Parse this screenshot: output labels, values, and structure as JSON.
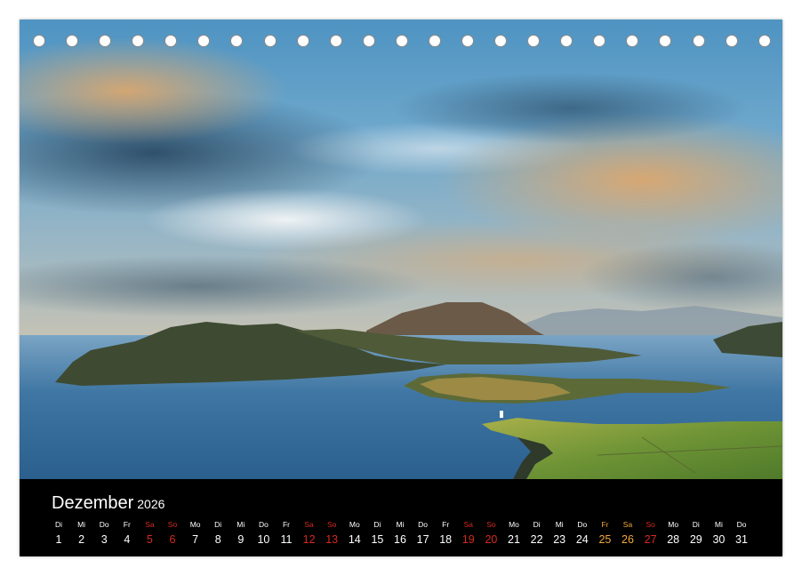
{
  "calendar": {
    "month": "Dezember",
    "year": "2026",
    "ring_count": 23,
    "colors": {
      "weekday": "#ffffff",
      "weekend": "#d62a20",
      "holiday": "#f2a93b"
    },
    "days": [
      {
        "wd": "Di",
        "num": "1",
        "type": "normal"
      },
      {
        "wd": "Mi",
        "num": "2",
        "type": "normal"
      },
      {
        "wd": "Do",
        "num": "3",
        "type": "normal"
      },
      {
        "wd": "Fr",
        "num": "4",
        "type": "normal"
      },
      {
        "wd": "Sa",
        "num": "5",
        "type": "weekend"
      },
      {
        "wd": "So",
        "num": "6",
        "type": "weekend"
      },
      {
        "wd": "Mo",
        "num": "7",
        "type": "normal"
      },
      {
        "wd": "Di",
        "num": "8",
        "type": "normal"
      },
      {
        "wd": "Mi",
        "num": "9",
        "type": "normal"
      },
      {
        "wd": "Do",
        "num": "10",
        "type": "normal"
      },
      {
        "wd": "Fr",
        "num": "11",
        "type": "normal"
      },
      {
        "wd": "Sa",
        "num": "12",
        "type": "weekend"
      },
      {
        "wd": "So",
        "num": "13",
        "type": "weekend"
      },
      {
        "wd": "Mo",
        "num": "14",
        "type": "normal"
      },
      {
        "wd": "Di",
        "num": "15",
        "type": "normal"
      },
      {
        "wd": "Mi",
        "num": "16",
        "type": "normal"
      },
      {
        "wd": "Do",
        "num": "17",
        "type": "normal"
      },
      {
        "wd": "Fr",
        "num": "18",
        "type": "normal"
      },
      {
        "wd": "Sa",
        "num": "19",
        "type": "weekend"
      },
      {
        "wd": "So",
        "num": "20",
        "type": "weekend"
      },
      {
        "wd": "Mo",
        "num": "21",
        "type": "normal"
      },
      {
        "wd": "Di",
        "num": "22",
        "type": "normal"
      },
      {
        "wd": "Mi",
        "num": "23",
        "type": "normal"
      },
      {
        "wd": "Do",
        "num": "24",
        "type": "normal"
      },
      {
        "wd": "Fr",
        "num": "25",
        "type": "holiday"
      },
      {
        "wd": "Sa",
        "num": "26",
        "type": "holiday"
      },
      {
        "wd": "So",
        "num": "27",
        "type": "weekend"
      },
      {
        "wd": "Mo",
        "num": "28",
        "type": "normal"
      },
      {
        "wd": "Di",
        "num": "29",
        "type": "normal"
      },
      {
        "wd": "Mi",
        "num": "30",
        "type": "normal"
      },
      {
        "wd": "Do",
        "num": "31",
        "type": "normal"
      }
    ]
  }
}
